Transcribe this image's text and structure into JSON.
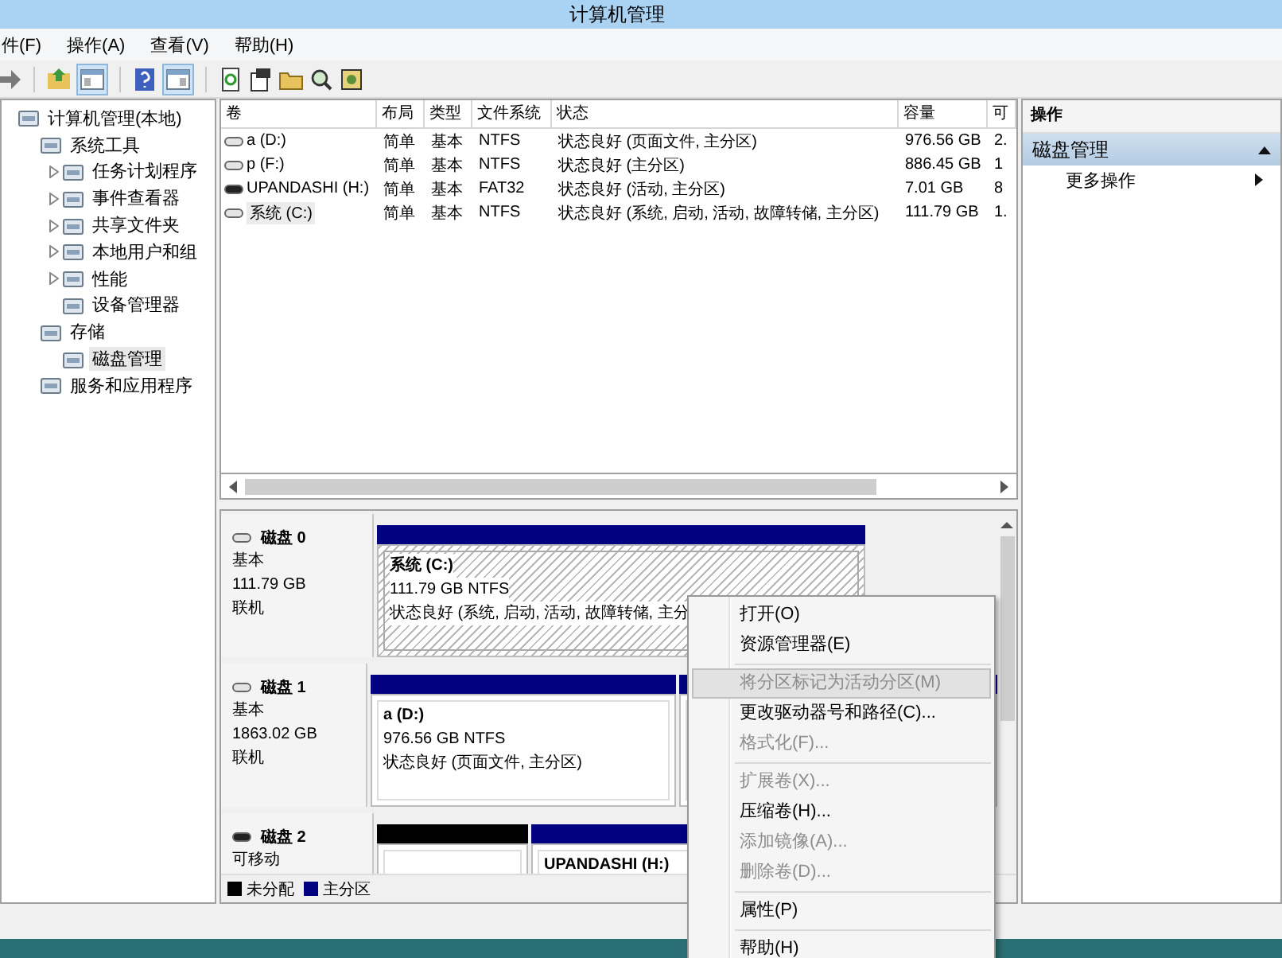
{
  "window": {
    "title": "计算机管理"
  },
  "menu": [
    "件(F)",
    "操作(A)",
    "查看(V)",
    "帮助(H)"
  ],
  "tree": [
    {
      "label": "计算机管理(本地)",
      "expanded": true,
      "selected": false,
      "children": [
        {
          "label": "系统工具",
          "expanded": true,
          "selected": false,
          "children": [
            {
              "label": "任务计划程序",
              "expanded": false,
              "selected": false
            },
            {
              "label": "事件查看器",
              "expanded": false,
              "selected": false
            },
            {
              "label": "共享文件夹",
              "expanded": false,
              "selected": false
            },
            {
              "label": "本地用户和组",
              "expanded": false,
              "selected": false
            },
            {
              "label": "性能",
              "expanded": false,
              "selected": false
            },
            {
              "label": "设备管理器",
              "selected": false
            }
          ]
        },
        {
          "label": "存储",
          "expanded": true,
          "selected": false,
          "children": [
            {
              "label": "磁盘管理",
              "selected": true
            }
          ]
        },
        {
          "label": "服务和应用程序",
          "selected": false
        }
      ]
    }
  ],
  "volumes": {
    "columns": [
      "卷",
      "布局",
      "类型",
      "文件系统",
      "状态",
      "容量",
      "可"
    ],
    "rows": [
      {
        "kind": "fixed",
        "selected": false,
        "cells": [
          "a (D:)",
          "简单",
          "基本",
          "NTFS",
          "状态良好 (页面文件, 主分区)",
          "976.56 GB",
          "2."
        ]
      },
      {
        "kind": "fixed",
        "selected": false,
        "cells": [
          "p (F:)",
          "简单",
          "基本",
          "NTFS",
          "状态良好 (主分区)",
          "886.45 GB",
          "1"
        ]
      },
      {
        "kind": "removable",
        "selected": false,
        "cells": [
          "UPANDASHI (H:)",
          "简单",
          "基本",
          "FAT32",
          "状态良好 (活动, 主分区)",
          "7.01 GB",
          "8"
        ]
      },
      {
        "kind": "fixed",
        "selected": true,
        "cells": [
          "系统 (C:)",
          "简单",
          "基本",
          "NTFS",
          "状态良好 (系统, 启动, 活动, 故障转储, 主分区)",
          "111.79 GB",
          "1."
        ]
      }
    ]
  },
  "disks": [
    {
      "kind": "fixed",
      "name": "磁盘 0",
      "type": "基本",
      "size": "111.79 GB",
      "status": "联机",
      "partitions": [
        {
          "color": "#000080",
          "selected": true,
          "name": "系统  (C:)",
          "detail": "111.79 GB NTFS",
          "status": "状态良好 (系统, 启动, 活动, 故障转储, 主分"
        }
      ]
    },
    {
      "kind": "fixed",
      "name": "磁盘 1",
      "type": "基本",
      "size": "1863.02 GB",
      "status": "联机",
      "partitions": [
        {
          "color": "#000080",
          "selected": false,
          "name": "a  (D:)",
          "detail": "976.56 GB NTFS",
          "status": "状态良好 (页面文件, 主分区)"
        },
        {
          "color": "#000080",
          "selected": false
        }
      ]
    },
    {
      "kind": "removable",
      "name": "磁盘 2",
      "type": "可移动",
      "partitions": [
        {
          "color": "#000000",
          "selected": false
        },
        {
          "color": "#000080",
          "selected": false,
          "name": "UPANDASHI  (H:)"
        }
      ]
    }
  ],
  "legend": [
    {
      "label": "未分配",
      "color": "#000000"
    },
    {
      "label": "主分区",
      "color": "#000080"
    }
  ],
  "actions": {
    "header": "操作",
    "section": "磁盘管理",
    "expanded": true,
    "items": [
      "更多操作"
    ]
  },
  "context_menu": [
    {
      "kind": "item",
      "label": "打开(O)",
      "disabled": false,
      "selected": false
    },
    {
      "kind": "item",
      "label": "资源管理器(E)",
      "disabled": false,
      "selected": false
    },
    {
      "kind": "separator"
    },
    {
      "kind": "item",
      "label": "将分区标记为活动分区(M)",
      "disabled": true,
      "selected": true
    },
    {
      "kind": "item",
      "label": "更改驱动器号和路径(C)...",
      "disabled": false,
      "selected": false
    },
    {
      "kind": "item",
      "label": "格式化(F)...",
      "disabled": true,
      "selected": false
    },
    {
      "kind": "separator"
    },
    {
      "kind": "item",
      "label": "扩展卷(X)...",
      "disabled": true,
      "selected": false
    },
    {
      "kind": "item",
      "label": "压缩卷(H)...",
      "disabled": false,
      "selected": false
    },
    {
      "kind": "item",
      "label": "添加镜像(A)...",
      "disabled": true,
      "selected": false
    },
    {
      "kind": "item",
      "label": "删除卷(D)...",
      "disabled": true,
      "selected": false
    },
    {
      "kind": "separator"
    },
    {
      "kind": "item",
      "label": "属性(P)",
      "disabled": false,
      "selected": false
    },
    {
      "kind": "separator"
    },
    {
      "kind": "item",
      "label": "帮助(H)",
      "disabled": false,
      "selected": false
    }
  ]
}
